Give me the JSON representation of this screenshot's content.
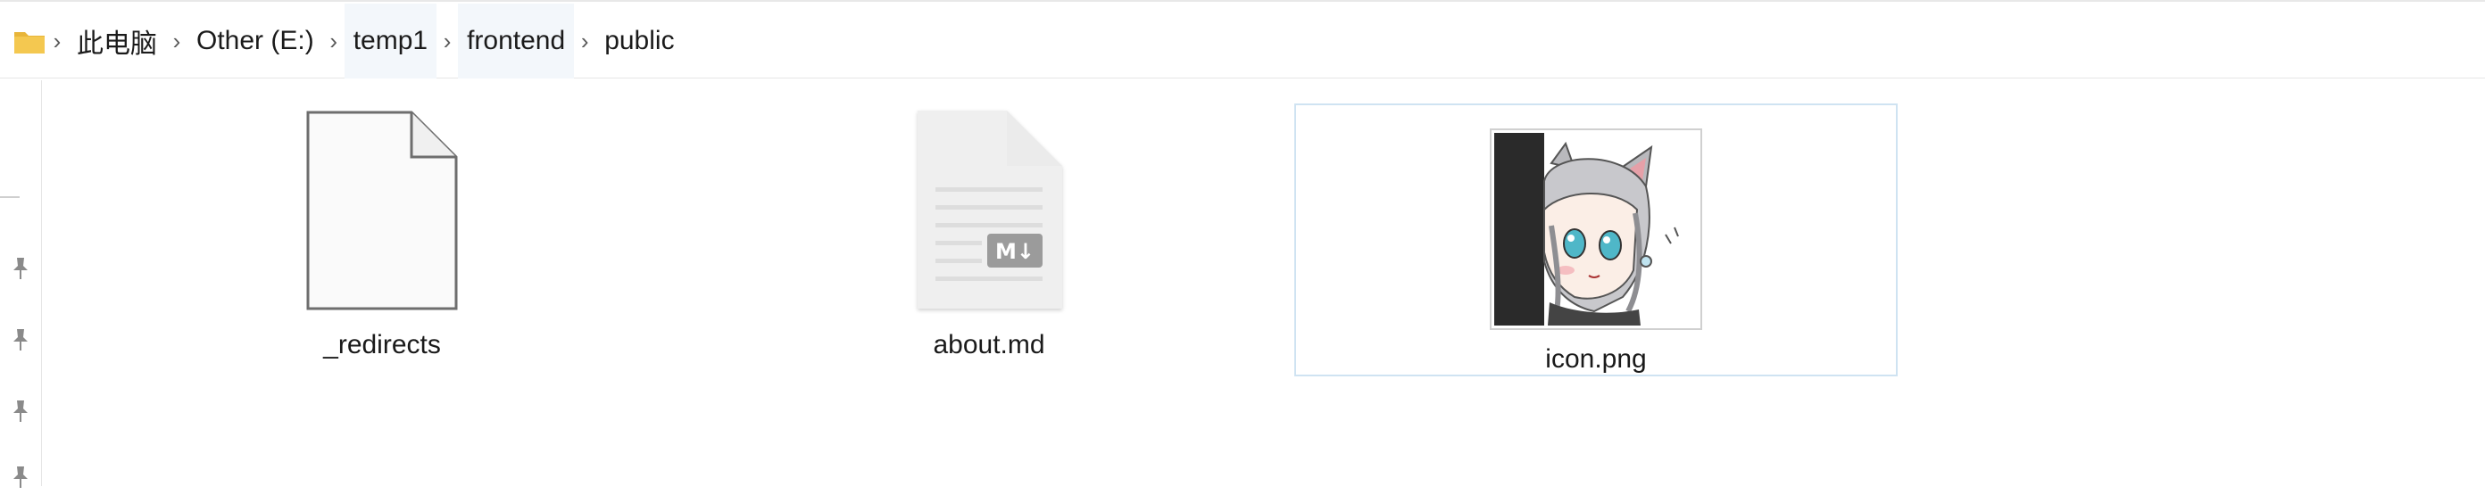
{
  "breadcrumb": {
    "folder_icon": "folder-icon",
    "items": [
      {
        "label": "此电脑"
      },
      {
        "label": "Other (E:)"
      },
      {
        "label": "temp1"
      },
      {
        "label": "frontend"
      },
      {
        "label": "public"
      }
    ]
  },
  "sidebar": {
    "pins": [
      "pin-icon",
      "pin-icon",
      "pin-icon",
      "pin-icon"
    ]
  },
  "files": [
    {
      "name": "_redirects",
      "icon": "blank-file-icon",
      "selected": false
    },
    {
      "name": "about.md",
      "icon": "markdown-file-icon",
      "badge": "M↓",
      "selected": false
    },
    {
      "name": "icon.png",
      "icon": "image-thumbnail",
      "selected": true
    }
  ],
  "colors": {
    "folder": "#f2c34a",
    "selection_border": "#cfe3f2",
    "markdown_badge": "#9b9b9b"
  }
}
